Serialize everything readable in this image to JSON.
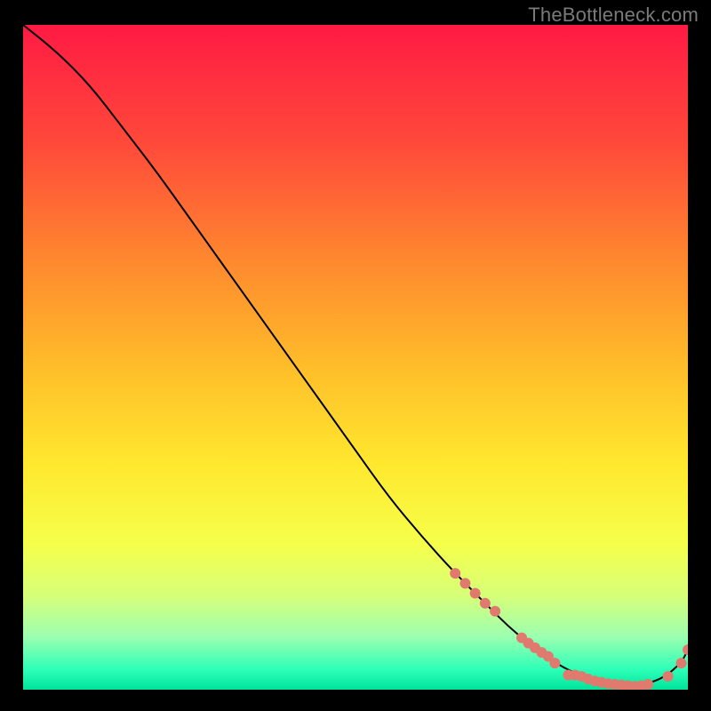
{
  "watermark": "TheBottleneck.com",
  "chart_data": {
    "type": "line",
    "title": "",
    "xlabel": "",
    "ylabel": "",
    "xlim": [
      0,
      100
    ],
    "ylim": [
      0,
      100
    ],
    "grid": false,
    "legend": false,
    "background_gradient": {
      "stops": [
        {
          "pos": 0.0,
          "color": "#ff1a44"
        },
        {
          "pos": 0.18,
          "color": "#ff4a3a"
        },
        {
          "pos": 0.36,
          "color": "#ff8a2e"
        },
        {
          "pos": 0.52,
          "color": "#ffbf2a"
        },
        {
          "pos": 0.66,
          "color": "#ffe82e"
        },
        {
          "pos": 0.78,
          "color": "#f6ff4a"
        },
        {
          "pos": 0.86,
          "color": "#d6ff7a"
        },
        {
          "pos": 0.92,
          "color": "#9cffb0"
        },
        {
          "pos": 0.97,
          "color": "#2dffb8"
        },
        {
          "pos": 1.0,
          "color": "#00e39a"
        }
      ]
    },
    "series": [
      {
        "name": "curve",
        "color": "#000000",
        "x": [
          0,
          5,
          10,
          15,
          20,
          25,
          30,
          35,
          40,
          45,
          50,
          55,
          60,
          65,
          70,
          73,
          76,
          80,
          84,
          88,
          92,
          96,
          99,
          100
        ],
        "y": [
          100,
          96,
          91,
          84.5,
          78,
          71,
          64,
          57,
          50,
          43,
          36,
          29,
          23,
          17.5,
          12.5,
          9.5,
          7.0,
          4.0,
          2.0,
          0.9,
          0.5,
          1.5,
          4.0,
          6.0
        ]
      }
    ],
    "points": {
      "name": "highlighted-points",
      "color": "#e07a6e",
      "radius": 6,
      "data": [
        {
          "x": 65.0,
          "y": 17.5
        },
        {
          "x": 66.5,
          "y": 16.0
        },
        {
          "x": 68.0,
          "y": 14.5
        },
        {
          "x": 69.5,
          "y": 13.0
        },
        {
          "x": 71.0,
          "y": 11.8
        },
        {
          "x": 75.0,
          "y": 7.8
        },
        {
          "x": 76.0,
          "y": 7.0
        },
        {
          "x": 77.0,
          "y": 6.3
        },
        {
          "x": 78.0,
          "y": 5.6
        },
        {
          "x": 79.0,
          "y": 5.0
        },
        {
          "x": 80.0,
          "y": 4.0
        },
        {
          "x": 82.0,
          "y": 2.2
        },
        {
          "x": 83.0,
          "y": 2.2
        },
        {
          "x": 84.0,
          "y": 2.0
        },
        {
          "x": 85.0,
          "y": 1.6
        },
        {
          "x": 86.0,
          "y": 1.3
        },
        {
          "x": 87.0,
          "y": 1.1
        },
        {
          "x": 88.0,
          "y": 0.9
        },
        {
          "x": 89.0,
          "y": 0.8
        },
        {
          "x": 90.0,
          "y": 0.7
        },
        {
          "x": 91.0,
          "y": 0.6
        },
        {
          "x": 92.0,
          "y": 0.5
        },
        {
          "x": 93.0,
          "y": 0.6
        },
        {
          "x": 94.0,
          "y": 0.8
        },
        {
          "x": 97.0,
          "y": 2.0
        },
        {
          "x": 99.0,
          "y": 4.0
        },
        {
          "x": 100.0,
          "y": 6.0
        }
      ]
    }
  }
}
